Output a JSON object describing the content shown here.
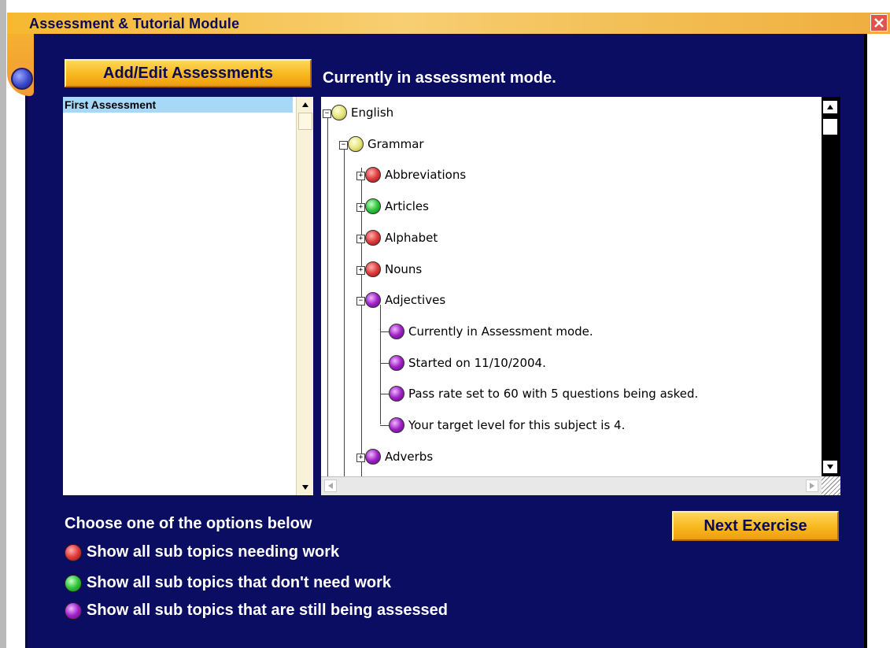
{
  "window": {
    "title": "Assessment & Tutorial Module",
    "close_icon": "close-icon"
  },
  "header": {
    "add_edit_button": "Add/Edit Assessments",
    "mode_text": "Currently in assessment mode."
  },
  "assessment_list": {
    "items": [
      "First Assessment"
    ],
    "selected_index": 0
  },
  "tree": {
    "nodes": [
      {
        "label": "English",
        "level": 0,
        "expander": "−",
        "status": "yellow"
      },
      {
        "label": "Grammar",
        "level": 1,
        "expander": "−",
        "status": "yellow"
      },
      {
        "label": "Abbreviations",
        "level": 2,
        "expander": "+",
        "status": "red"
      },
      {
        "label": "Articles",
        "level": 2,
        "expander": "+",
        "status": "green"
      },
      {
        "label": "Alphabet",
        "level": 2,
        "expander": "+",
        "status": "red"
      },
      {
        "label": "Nouns",
        "level": 2,
        "expander": "+",
        "status": "red"
      },
      {
        "label": "Adjectives",
        "level": 2,
        "expander": "−",
        "status": "purple"
      },
      {
        "label": "Currently in Assessment mode.",
        "level": 3,
        "expander": "",
        "status": "purple"
      },
      {
        "label": "Started on 11/10/2004.",
        "level": 3,
        "expander": "",
        "status": "purple"
      },
      {
        "label": "Pass rate set to 60 with 5 questions being asked.",
        "level": 3,
        "expander": "",
        "status": "purple"
      },
      {
        "label": "Your target level for this subject is 4.",
        "level": 3,
        "expander": "",
        "status": "purple"
      },
      {
        "label": "Adverbs",
        "level": 2,
        "expander": "+",
        "status": "purple"
      }
    ]
  },
  "options": {
    "heading": "Choose one of the options below",
    "items": [
      {
        "label": "Show all sub topics needing work",
        "color": "red"
      },
      {
        "label": "Show all sub topics that don't need work",
        "color": "green"
      },
      {
        "label": "Show all sub topics that are still being assessed",
        "color": "purple"
      }
    ]
  },
  "footer": {
    "next_button": "Next Exercise"
  },
  "colors": {
    "background": "#0b0d63",
    "accent_gold": "#f8b81e",
    "list_highlight": "#a8d8f8"
  }
}
